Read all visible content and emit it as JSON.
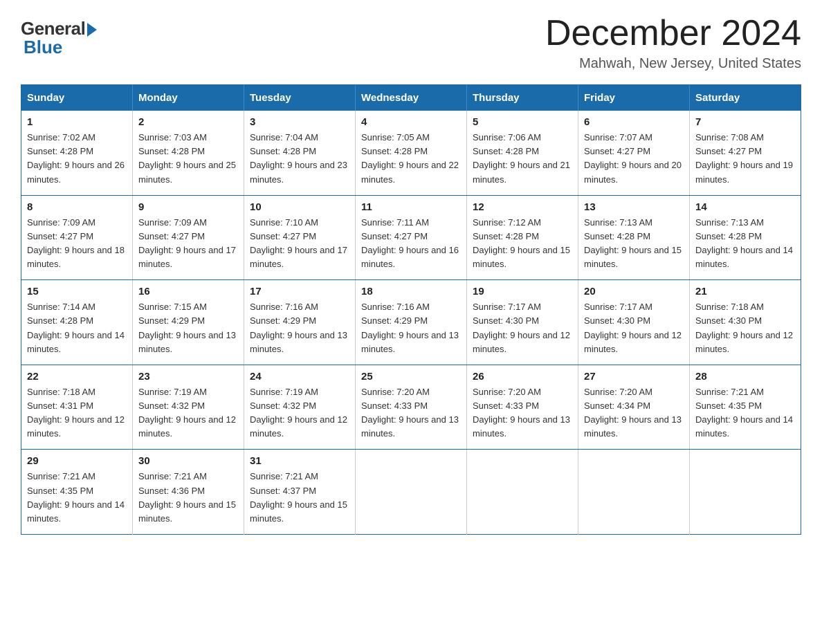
{
  "logo": {
    "general": "General",
    "blue": "Blue"
  },
  "title": {
    "month": "December 2024",
    "location": "Mahwah, New Jersey, United States"
  },
  "weekdays": [
    "Sunday",
    "Monday",
    "Tuesday",
    "Wednesday",
    "Thursday",
    "Friday",
    "Saturday"
  ],
  "weeks": [
    [
      {
        "day": "1",
        "sunrise": "7:02 AM",
        "sunset": "4:28 PM",
        "daylight": "9 hours and 26 minutes."
      },
      {
        "day": "2",
        "sunrise": "7:03 AM",
        "sunset": "4:28 PM",
        "daylight": "9 hours and 25 minutes."
      },
      {
        "day": "3",
        "sunrise": "7:04 AM",
        "sunset": "4:28 PM",
        "daylight": "9 hours and 23 minutes."
      },
      {
        "day": "4",
        "sunrise": "7:05 AM",
        "sunset": "4:28 PM",
        "daylight": "9 hours and 22 minutes."
      },
      {
        "day": "5",
        "sunrise": "7:06 AM",
        "sunset": "4:28 PM",
        "daylight": "9 hours and 21 minutes."
      },
      {
        "day": "6",
        "sunrise": "7:07 AM",
        "sunset": "4:27 PM",
        "daylight": "9 hours and 20 minutes."
      },
      {
        "day": "7",
        "sunrise": "7:08 AM",
        "sunset": "4:27 PM",
        "daylight": "9 hours and 19 minutes."
      }
    ],
    [
      {
        "day": "8",
        "sunrise": "7:09 AM",
        "sunset": "4:27 PM",
        "daylight": "9 hours and 18 minutes."
      },
      {
        "day": "9",
        "sunrise": "7:09 AM",
        "sunset": "4:27 PM",
        "daylight": "9 hours and 17 minutes."
      },
      {
        "day": "10",
        "sunrise": "7:10 AM",
        "sunset": "4:27 PM",
        "daylight": "9 hours and 17 minutes."
      },
      {
        "day": "11",
        "sunrise": "7:11 AM",
        "sunset": "4:27 PM",
        "daylight": "9 hours and 16 minutes."
      },
      {
        "day": "12",
        "sunrise": "7:12 AM",
        "sunset": "4:28 PM",
        "daylight": "9 hours and 15 minutes."
      },
      {
        "day": "13",
        "sunrise": "7:13 AM",
        "sunset": "4:28 PM",
        "daylight": "9 hours and 15 minutes."
      },
      {
        "day": "14",
        "sunrise": "7:13 AM",
        "sunset": "4:28 PM",
        "daylight": "9 hours and 14 minutes."
      }
    ],
    [
      {
        "day": "15",
        "sunrise": "7:14 AM",
        "sunset": "4:28 PM",
        "daylight": "9 hours and 14 minutes."
      },
      {
        "day": "16",
        "sunrise": "7:15 AM",
        "sunset": "4:29 PM",
        "daylight": "9 hours and 13 minutes."
      },
      {
        "day": "17",
        "sunrise": "7:16 AM",
        "sunset": "4:29 PM",
        "daylight": "9 hours and 13 minutes."
      },
      {
        "day": "18",
        "sunrise": "7:16 AM",
        "sunset": "4:29 PM",
        "daylight": "9 hours and 13 minutes."
      },
      {
        "day": "19",
        "sunrise": "7:17 AM",
        "sunset": "4:30 PM",
        "daylight": "9 hours and 12 minutes."
      },
      {
        "day": "20",
        "sunrise": "7:17 AM",
        "sunset": "4:30 PM",
        "daylight": "9 hours and 12 minutes."
      },
      {
        "day": "21",
        "sunrise": "7:18 AM",
        "sunset": "4:30 PM",
        "daylight": "9 hours and 12 minutes."
      }
    ],
    [
      {
        "day": "22",
        "sunrise": "7:18 AM",
        "sunset": "4:31 PM",
        "daylight": "9 hours and 12 minutes."
      },
      {
        "day": "23",
        "sunrise": "7:19 AM",
        "sunset": "4:32 PM",
        "daylight": "9 hours and 12 minutes."
      },
      {
        "day": "24",
        "sunrise": "7:19 AM",
        "sunset": "4:32 PM",
        "daylight": "9 hours and 12 minutes."
      },
      {
        "day": "25",
        "sunrise": "7:20 AM",
        "sunset": "4:33 PM",
        "daylight": "9 hours and 13 minutes."
      },
      {
        "day": "26",
        "sunrise": "7:20 AM",
        "sunset": "4:33 PM",
        "daylight": "9 hours and 13 minutes."
      },
      {
        "day": "27",
        "sunrise": "7:20 AM",
        "sunset": "4:34 PM",
        "daylight": "9 hours and 13 minutes."
      },
      {
        "day": "28",
        "sunrise": "7:21 AM",
        "sunset": "4:35 PM",
        "daylight": "9 hours and 14 minutes."
      }
    ],
    [
      {
        "day": "29",
        "sunrise": "7:21 AM",
        "sunset": "4:35 PM",
        "daylight": "9 hours and 14 minutes."
      },
      {
        "day": "30",
        "sunrise": "7:21 AM",
        "sunset": "4:36 PM",
        "daylight": "9 hours and 15 minutes."
      },
      {
        "day": "31",
        "sunrise": "7:21 AM",
        "sunset": "4:37 PM",
        "daylight": "9 hours and 15 minutes."
      },
      null,
      null,
      null,
      null
    ]
  ]
}
